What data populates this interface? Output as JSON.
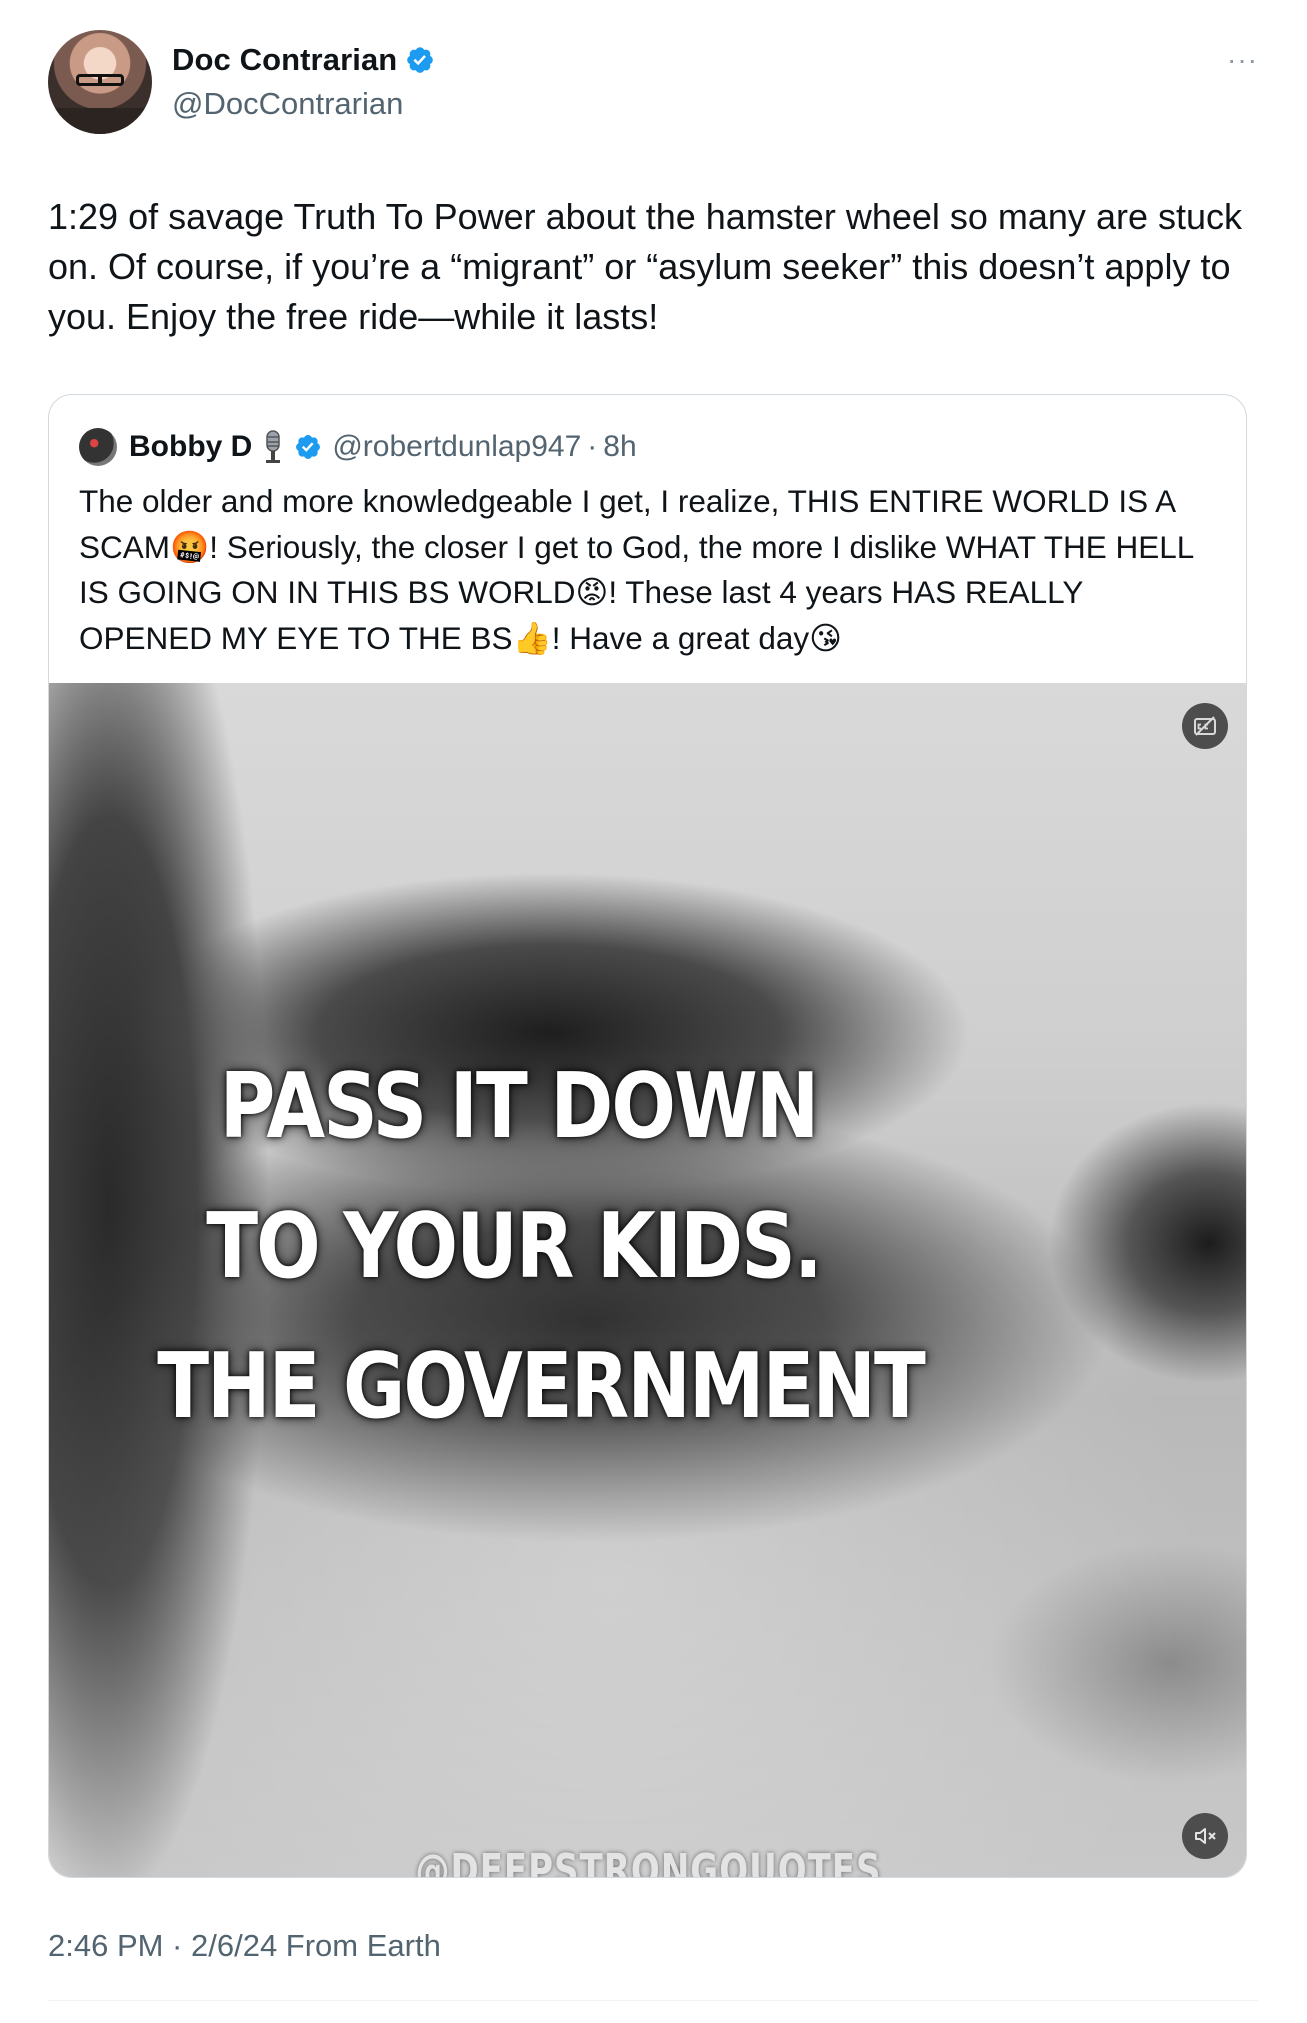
{
  "author": {
    "name": "Doc Contrarian",
    "handle": "@DocContrarian",
    "verified_color": "#1d9bf0",
    "avatar_icon": "profile-photo"
  },
  "more_icon_text": "···",
  "tweet_text": "1:29 of savage Truth To Power about the hamster wheel so many are stuck on. Of course, if you’re a “migrant” or “asylum seeker” this doesn’t apply to you. Enjoy the free ride—while it lasts!",
  "quote": {
    "name": "Bobby D",
    "name_emoji_icon": "microphone-icon",
    "handle": "@robertdunlap947",
    "separator": "·",
    "time": "8h",
    "text": "The older and more knowledgeable I get, I realize, THIS ENTIRE WORLD IS A SCAM🤬! Seriously, the closer I get to God, the more I dislike WHAT THE HELL IS GOING ON IN THIS BS WORLD😡! These last 4 years HAS REALLY OPENED MY EYE TO THE BS👍! Have a great day😘",
    "media": {
      "caption_lines": [
        "PASS IT DOWN",
        "TO YOUR KIDS.",
        "THE GOVERNMENT"
      ],
      "watermark": "@DEEPSTRONGQUOTES",
      "controls": [
        "captions-off-icon",
        "mute-icon"
      ]
    }
  },
  "meta": "2:46 PM · 2/6/24 From Earth"
}
